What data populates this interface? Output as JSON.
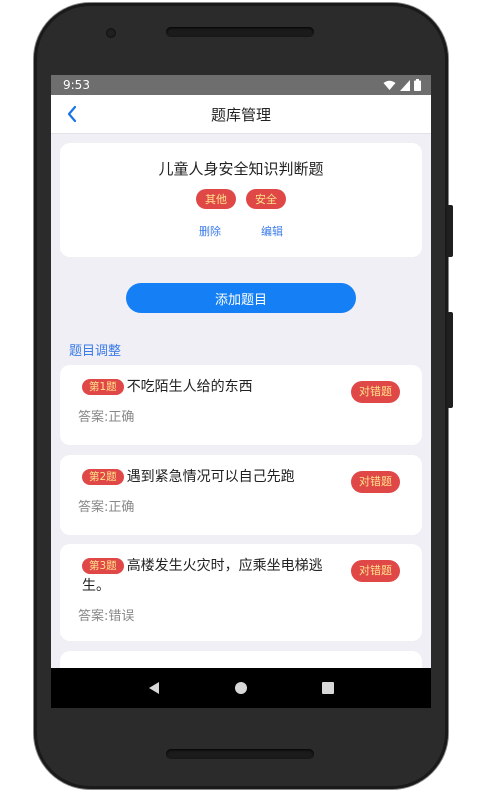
{
  "status": {
    "time": "9:53"
  },
  "header": {
    "title": "题库管理"
  },
  "bank": {
    "title": "儿童人身安全知识判断题",
    "tags": [
      "其他",
      "安全"
    ],
    "delete_label": "删除",
    "edit_label": "编辑"
  },
  "add_button": "添加题目",
  "section_label": "题目调整",
  "questions": [
    {
      "num": "第1题",
      "text": "不吃陌生人给的东西",
      "type": "对错题",
      "answer": "答案:正确"
    },
    {
      "num": "第2题",
      "text": "遇到紧急情况可以自己先跑",
      "type": "对错题",
      "answer": "答案:正确"
    },
    {
      "num": "第3题",
      "text": "高楼发生火灾时，应乘坐电梯逃生。",
      "type": "对错题",
      "answer": "答案:错误"
    }
  ],
  "colors": {
    "accent": "#1580f5",
    "tag_bg": "#e04848",
    "tag_text": "#ffe38a",
    "link": "#3a7be8"
  },
  "icons": {
    "back": "chevron-left-icon",
    "wifi": "wifi-icon",
    "signal": "signal-icon",
    "battery": "battery-icon"
  }
}
